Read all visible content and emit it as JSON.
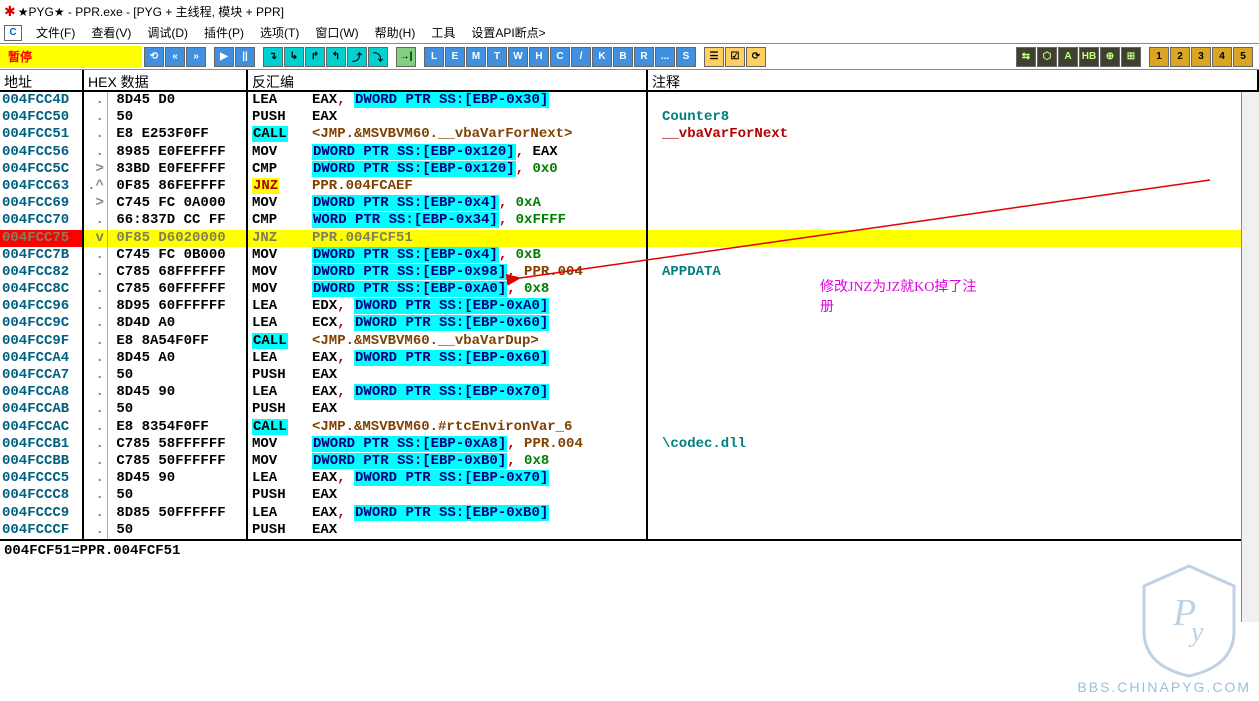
{
  "window": {
    "title": "★PYG★ - PPR.exe - [PYG + 主线程, 模块 + PPR]"
  },
  "menu": {
    "items": [
      "文件(F)",
      "查看(V)",
      "调试(D)",
      "插件(P)",
      "选项(T)",
      "窗口(W)",
      "帮助(H)",
      "工具",
      "设置API断点>"
    ]
  },
  "status": {
    "paused": "暂停"
  },
  "toolbar": {
    "nav": [
      "⟲",
      "«",
      "»"
    ],
    "exec": [
      "▶",
      "||"
    ],
    "step": [
      "↴",
      "↳",
      "↱",
      "↰",
      "⤴",
      "⤵"
    ],
    "jmp": [
      "→|"
    ],
    "letters": [
      "L",
      "E",
      "M",
      "T",
      "W",
      "H",
      "C",
      "/",
      "K",
      "B",
      "R",
      "...",
      "S"
    ],
    "util": [
      "☰",
      "☑",
      "⟳"
    ],
    "dark": [
      "⇆",
      "⬡",
      "A",
      "HB",
      "⊕",
      "⊞"
    ],
    "nums": [
      "1",
      "2",
      "3",
      "4",
      "5"
    ]
  },
  "headers": {
    "addr": "地址",
    "hex": "HEX 数据",
    "disasm": "反汇编",
    "comment": "注释"
  },
  "rows": [
    {
      "addr": "004FCC4D",
      "m": ".",
      "hex": "8D45 D0",
      "mnem": "LEA",
      "ops": [
        {
          "t": "EAX"
        },
        {
          "t": ", "
        },
        {
          "t": "DWORD PTR SS:[EBP-0x30]",
          "c": "cyan"
        }
      ],
      "comment": ""
    },
    {
      "addr": "004FCC50",
      "m": ".",
      "hex": "50",
      "mnem": "PUSH",
      "ops": [
        {
          "t": "EAX"
        }
      ],
      "comment": "Counter8",
      "cc": "teal"
    },
    {
      "addr": "004FCC51",
      "m": ".",
      "hex": "E8 E253F0FF",
      "mnem": "CALL",
      "mc": "call",
      "ops": [
        {
          "t": "<JMP.&MSVBVM60.__vbaVarForNext>",
          "c": "brown"
        }
      ],
      "comment": "__vbaVarForNext",
      "cc": "red"
    },
    {
      "addr": "004FCC56",
      "m": ".",
      "hex": "8985 E0FEFFFF",
      "mnem": "MOV",
      "ops": [
        {
          "t": "DWORD PTR SS:[EBP-0x120]",
          "c": "cyan"
        },
        {
          "t": ", "
        },
        {
          "t": "EAX"
        }
      ],
      "comment": ""
    },
    {
      "addr": "004FCC5C",
      "m": ">",
      "hex": "83BD E0FEFFFF",
      "mnem": "CMP",
      "ops": [
        {
          "t": "DWORD PTR SS:[EBP-0x120]",
          "c": "cyan"
        },
        {
          "t": ", "
        },
        {
          "t": "0x0",
          "c": "green"
        }
      ],
      "comment": ""
    },
    {
      "addr": "004FCC63",
      "m": ".^",
      "hex": "0F85 86FEFFFF",
      "mnem": "JNZ",
      "mc": "jnz",
      "ops": [
        {
          "t": "PPR.004FCAEF",
          "c": "brown"
        }
      ],
      "comment": ""
    },
    {
      "addr": "004FCC69",
      "m": ">",
      "hex": "C745 FC 0A000",
      "mnem": "MOV",
      "ops": [
        {
          "t": "DWORD PTR SS:[EBP-0x4]",
          "c": "cyan"
        },
        {
          "t": ", "
        },
        {
          "t": "0xA",
          "c": "green"
        }
      ],
      "comment": ""
    },
    {
      "addr": "004FCC70",
      "m": ".",
      "hex": "66:837D CC FF",
      "mnem": "CMP",
      "ops": [
        {
          "t": "WORD PTR SS:[EBP-0x34]",
          "c": "cyan"
        },
        {
          "t": ", "
        },
        {
          "t": "0xFFFF",
          "c": "green"
        }
      ],
      "comment": ""
    },
    {
      "addr": "004FCC75",
      "m": "v",
      "hex": "0F85 D6020000",
      "mnem": "JNZ",
      "ops": [
        {
          "t": "PPR.004FCF51"
        }
      ],
      "eip": true,
      "hl": true,
      "comment": ""
    },
    {
      "addr": "004FCC7B",
      "m": ".",
      "hex": "C745 FC 0B000",
      "mnem": "MOV",
      "ops": [
        {
          "t": "DWORD PTR SS:[EBP-0x4]",
          "c": "cyan"
        },
        {
          "t": ", "
        },
        {
          "t": "0xB",
          "c": "green"
        }
      ],
      "comment": ""
    },
    {
      "addr": "004FCC82",
      "m": ".",
      "hex": "C785 68FFFFFF",
      "mnem": "MOV",
      "ops": [
        {
          "t": "DWORD PTR SS:[EBP-0x98]",
          "c": "cyan"
        },
        {
          "t": ", "
        },
        {
          "t": "PPR.004",
          "c": "brown"
        }
      ],
      "comment": "APPDATA",
      "cc": "teal"
    },
    {
      "addr": "004FCC8C",
      "m": ".",
      "hex": "C785 60FFFFFF",
      "mnem": "MOV",
      "ops": [
        {
          "t": "DWORD PTR SS:[EBP-0xA0]",
          "c": "cyan"
        },
        {
          "t": ", "
        },
        {
          "t": "0x8",
          "c": "green"
        }
      ],
      "comment": ""
    },
    {
      "addr": "004FCC96",
      "m": ".",
      "hex": "8D95 60FFFFFF",
      "mnem": "LEA",
      "ops": [
        {
          "t": "EDX"
        },
        {
          "t": ", "
        },
        {
          "t": "DWORD PTR SS:[EBP-0xA0]",
          "c": "cyan"
        }
      ],
      "comment": ""
    },
    {
      "addr": "004FCC9C",
      "m": ".",
      "hex": "8D4D A0",
      "mnem": "LEA",
      "ops": [
        {
          "t": "ECX"
        },
        {
          "t": ", "
        },
        {
          "t": "DWORD PTR SS:[EBP-0x60]",
          "c": "cyan"
        }
      ],
      "comment": ""
    },
    {
      "addr": "004FCC9F",
      "m": ".",
      "hex": "E8 8A54F0FF",
      "mnem": "CALL",
      "mc": "call",
      "ops": [
        {
          "t": "<JMP.&MSVBVM60.__vbaVarDup>",
          "c": "brown"
        }
      ],
      "comment": ""
    },
    {
      "addr": "004FCCA4",
      "m": ".",
      "hex": "8D45 A0",
      "mnem": "LEA",
      "ops": [
        {
          "t": "EAX"
        },
        {
          "t": ", "
        },
        {
          "t": "DWORD PTR SS:[EBP-0x60]",
          "c": "cyan"
        }
      ],
      "comment": ""
    },
    {
      "addr": "004FCCA7",
      "m": ".",
      "hex": "50",
      "mnem": "PUSH",
      "ops": [
        {
          "t": "EAX"
        }
      ],
      "comment": ""
    },
    {
      "addr": "004FCCA8",
      "m": ".",
      "hex": "8D45 90",
      "mnem": "LEA",
      "ops": [
        {
          "t": "EAX"
        },
        {
          "t": ", "
        },
        {
          "t": "DWORD PTR SS:[EBP-0x70]",
          "c": "cyan"
        }
      ],
      "comment": ""
    },
    {
      "addr": "004FCCAB",
      "m": ".",
      "hex": "50",
      "mnem": "PUSH",
      "ops": [
        {
          "t": "EAX"
        }
      ],
      "comment": ""
    },
    {
      "addr": "004FCCAC",
      "m": ".",
      "hex": "E8 8354F0FF",
      "mnem": "CALL",
      "mc": "call",
      "ops": [
        {
          "t": "<JMP.&MSVBVM60.#rtcEnvironVar_6",
          "c": "brown"
        }
      ],
      "comment": ""
    },
    {
      "addr": "004FCCB1",
      "m": ".",
      "hex": "C785 58FFFFFF",
      "mnem": "MOV",
      "ops": [
        {
          "t": "DWORD PTR SS:[EBP-0xA8]",
          "c": "cyan"
        },
        {
          "t": ", "
        },
        {
          "t": "PPR.004",
          "c": "brown"
        }
      ],
      "comment": "\\codec.dll",
      "cc": "teal"
    },
    {
      "addr": "004FCCBB",
      "m": ".",
      "hex": "C785 50FFFFFF",
      "mnem": "MOV",
      "ops": [
        {
          "t": "DWORD PTR SS:[EBP-0xB0]",
          "c": "cyan"
        },
        {
          "t": ", "
        },
        {
          "t": "0x8",
          "c": "green"
        }
      ],
      "comment": ""
    },
    {
      "addr": "004FCCC5",
      "m": ".",
      "hex": "8D45 90",
      "mnem": "LEA",
      "ops": [
        {
          "t": "EAX"
        },
        {
          "t": ", "
        },
        {
          "t": "DWORD PTR SS:[EBP-0x70]",
          "c": "cyan"
        }
      ],
      "comment": ""
    },
    {
      "addr": "004FCCC8",
      "m": ".",
      "hex": "50",
      "mnem": "PUSH",
      "ops": [
        {
          "t": "EAX"
        }
      ],
      "comment": ""
    },
    {
      "addr": "004FCCC9",
      "m": ".",
      "hex": "8D85 50FFFFFF",
      "mnem": "LEA",
      "ops": [
        {
          "t": "EAX"
        },
        {
          "t": ", "
        },
        {
          "t": "DWORD PTR SS:[EBP-0xB0]",
          "c": "cyan"
        }
      ],
      "comment": ""
    },
    {
      "addr": "004FCCCF",
      "m": ".",
      "hex": "50",
      "mnem": "PUSH",
      "ops": [
        {
          "t": "EAX"
        }
      ],
      "comment": ""
    }
  ],
  "statusline": "004FCF51=PPR.004FCF51",
  "annotation": "修改JNZ为JZ就KO掉了注册",
  "watermark": "BBS.CHINAPYG.COM"
}
